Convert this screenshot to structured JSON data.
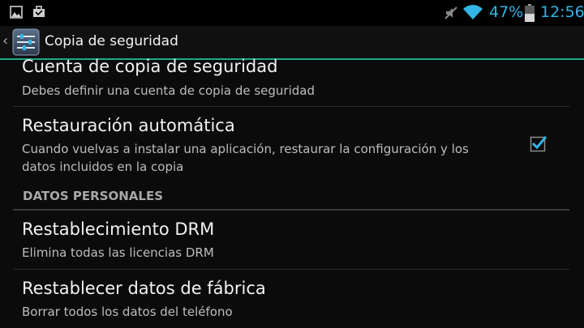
{
  "status_bar": {
    "battery_percent": "47%",
    "clock": "12:56",
    "accent_color": "#33b5e5",
    "icons_left": [
      "gallery-notification-icon",
      "briefcase-notification-icon"
    ],
    "icons_right": [
      "muted-icon",
      "wifi-icon",
      "battery-icon"
    ]
  },
  "action_bar": {
    "title": "Copia de seguridad",
    "app_icon": "settings-icon",
    "divider_color": "#1fa884"
  },
  "list": {
    "backup_account": {
      "title": "Cuenta de copia de seguridad",
      "summary": "Debes definir una cuenta de copia de seguridad"
    },
    "auto_restore": {
      "title": "Restauración automática",
      "summary_line1": "Cuando vuelvas a instalar una aplicación, restaurar la configuración y los",
      "summary_line2": "datos incluidos en la copia",
      "checked": true
    },
    "section_header": "DATOS PERSONALES",
    "drm_reset": {
      "title": "Restablecimiento DRM",
      "summary": "Elimina todas las licencias DRM"
    },
    "factory_reset": {
      "title": "Restablecer datos de fábrica",
      "summary": "Borrar todos los datos del teléfono"
    }
  }
}
